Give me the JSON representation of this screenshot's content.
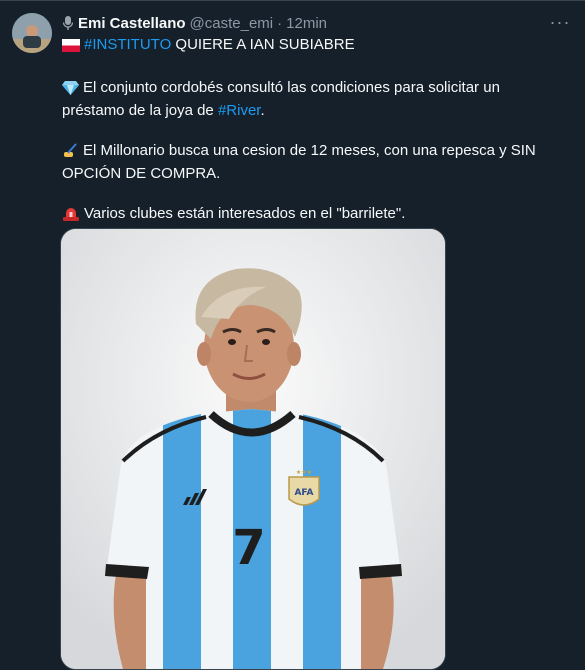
{
  "tweet": {
    "author_name": "Emi Castellano",
    "handle": "@caste_emi",
    "separator": "·",
    "time": "12min",
    "line1_hashtag": "#INSTITUTO",
    "line1_text": " QUIERE A IAN SUBIABRE",
    "para1_text_a": "El conjunto cordobés consultó las condiciones para solicitar un",
    "para1_text_b": "préstamo de la joya de ",
    "para1_hashtag": "#River",
    "para1_end": ".",
    "para2_text_a": "El Millonario busca una cesion de 12 meses, con una repesca y SIN",
    "para2_text_b": "OPCIÓN DE COMPRA.",
    "para3_text": "Varios clubes están interesados en el \"barrilete\".",
    "jersey_number": "7",
    "crest_text": "AFA"
  },
  "icons": {
    "mic": "microphone-icon",
    "flag": "poland-flag-icon",
    "gem": "gem-icon",
    "writing": "writing-hand-icon",
    "siren": "siren-icon",
    "more": "more-icon"
  },
  "colors": {
    "background": "#15202b",
    "link": "#1d9bf0",
    "secondary_text": "#8b98a5",
    "jersey_blue": "#4aa3df"
  }
}
